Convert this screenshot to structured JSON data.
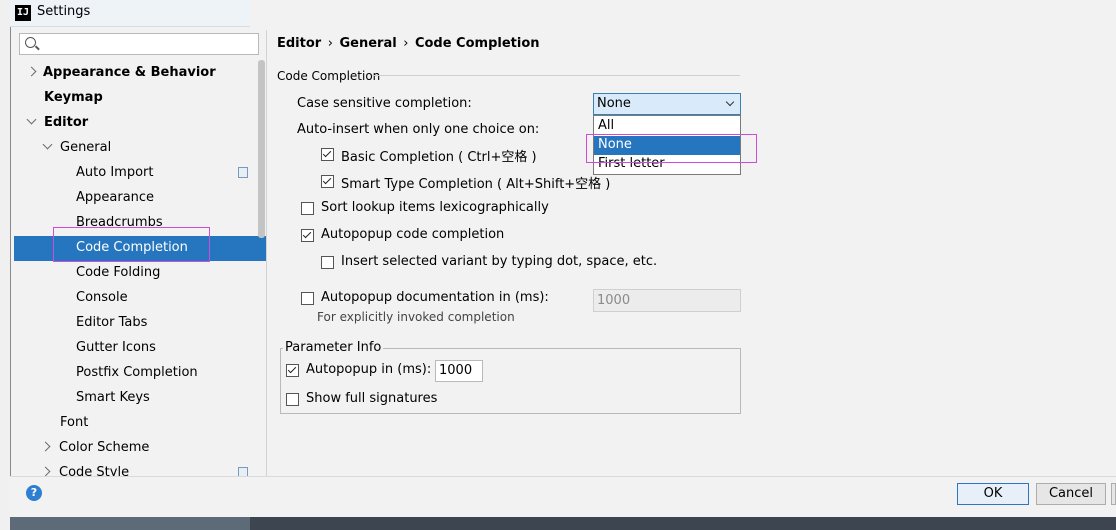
{
  "window": {
    "title": "Settings",
    "app_icon": "IJ"
  },
  "search": {
    "placeholder": ""
  },
  "sidebar": {
    "items": [
      {
        "label": "Appearance & Behavior",
        "expander": "chevron-right"
      },
      {
        "label": "Keymap"
      },
      {
        "label": "Editor",
        "expander": "chevron-down"
      },
      {
        "label": "General",
        "expander": "chevron-down"
      },
      {
        "label": "Auto Import"
      },
      {
        "label": "Appearance"
      },
      {
        "label": "Breadcrumbs"
      },
      {
        "label": "Code Completion",
        "selected": true
      },
      {
        "label": "Code Folding"
      },
      {
        "label": "Console"
      },
      {
        "label": "Editor Tabs"
      },
      {
        "label": "Gutter Icons"
      },
      {
        "label": "Postfix Completion"
      },
      {
        "label": "Smart Keys"
      },
      {
        "label": "Font"
      },
      {
        "label": "Color Scheme",
        "expander": "chevron-right"
      },
      {
        "label": "Code Style",
        "expander": "chevron-right"
      }
    ]
  },
  "breadcrumb": {
    "part1": "Editor",
    "sep1": "›",
    "part2": "General",
    "sep2": "›",
    "part3": "Code Completion"
  },
  "code_completion": {
    "section_title": "Code Completion",
    "case_sensitive_label": "Case sensitive completion:",
    "case_sensitive_value": "None",
    "dropdown_options": [
      "All",
      "None",
      "First letter"
    ],
    "auto_insert_label": "Auto-insert when only one choice on:",
    "basic_completion": "Basic Completion ( Ctrl+空格 )",
    "smart_type_completion": "Smart Type Completion ( Alt+Shift+空格 )",
    "sort_lookup": "Sort lookup items lexicographically",
    "autopopup_completion": "Autopopup code completion",
    "insert_selected_variant": "Insert selected variant by typing dot, space, etc.",
    "autopopup_documentation": "Autopopup documentation in (ms):",
    "autopopup_documentation_value": "1000",
    "explicit_hint": "For explicitly invoked completion"
  },
  "parameter_info": {
    "title": "Parameter Info",
    "autopopup_label": "Autopopup in (ms):",
    "autopopup_value": "1000",
    "show_full_signatures": "Show full signatures"
  },
  "footer": {
    "help": "?",
    "ok": "OK",
    "cancel": "Cancel"
  },
  "colors": {
    "accent": "#2675bf",
    "highlight": "#d04bd8"
  }
}
